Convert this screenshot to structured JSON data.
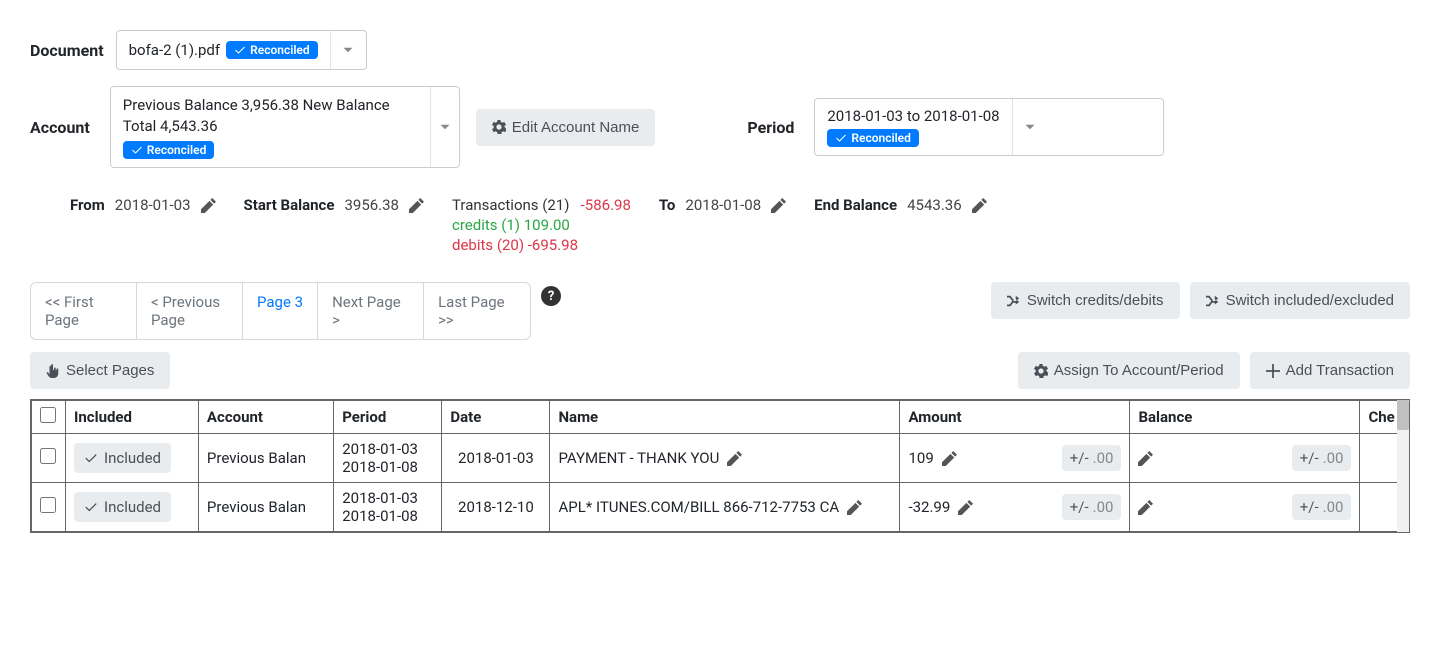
{
  "document": {
    "label": "Document",
    "filename": "bofa-2 (1).pdf",
    "badge": "Reconciled"
  },
  "account": {
    "label": "Account",
    "line1": "Previous Balance 3,956.38 New Balance Total 4,543.36",
    "badge": "Reconciled",
    "edit_button": "Edit Account Name"
  },
  "period": {
    "label": "Period",
    "range": "2018-01-03 to 2018-01-08",
    "badge": "Reconciled"
  },
  "stats": {
    "from_label": "From",
    "from_value": "2018-01-03",
    "start_balance_label": "Start Balance",
    "start_balance_value": "3956.38",
    "transactions_label": "Transactions (21)",
    "transactions_net": "-586.98",
    "credits": "credits (1) 109.00",
    "debits": "debits (20) -695.98",
    "to_label": "To",
    "to_value": "2018-01-08",
    "end_balance_label": "End Balance",
    "end_balance_value": "4543.36"
  },
  "pagination": {
    "first": "<< First Page",
    "prev": "< Previous Page",
    "current": "Page 3",
    "next": "Next Page >",
    "last": "Last Page >>"
  },
  "buttons": {
    "switch_credits": "Switch credits/debits",
    "switch_included": "Switch included/excluded",
    "select_pages": "Select Pages",
    "assign": "Assign To Account/Period",
    "add_transaction": "Add Transaction"
  },
  "table": {
    "headers": {
      "included": "Included",
      "account": "Account",
      "period": "Period",
      "date": "Date",
      "name": "Name",
      "amount": "Amount",
      "balance": "Balance",
      "check": "Che"
    },
    "pill_plus_minus": "+/-",
    "pill_decimal": ".00",
    "rows": [
      {
        "included": "Included",
        "account": "Previous Balan",
        "period_from": "2018-01-03",
        "period_to": "2018-01-08",
        "date": "2018-01-03",
        "name": "PAYMENT - THANK YOU",
        "amount": "109",
        "balance": ""
      },
      {
        "included": "Included",
        "account": "Previous Balan",
        "period_from": "2018-01-03",
        "period_to": "2018-01-08",
        "date": "2018-12-10",
        "name": "APL* ITUNES.COM/BILL 866-712-7753 CA",
        "amount": "-32.99",
        "balance": ""
      }
    ]
  }
}
